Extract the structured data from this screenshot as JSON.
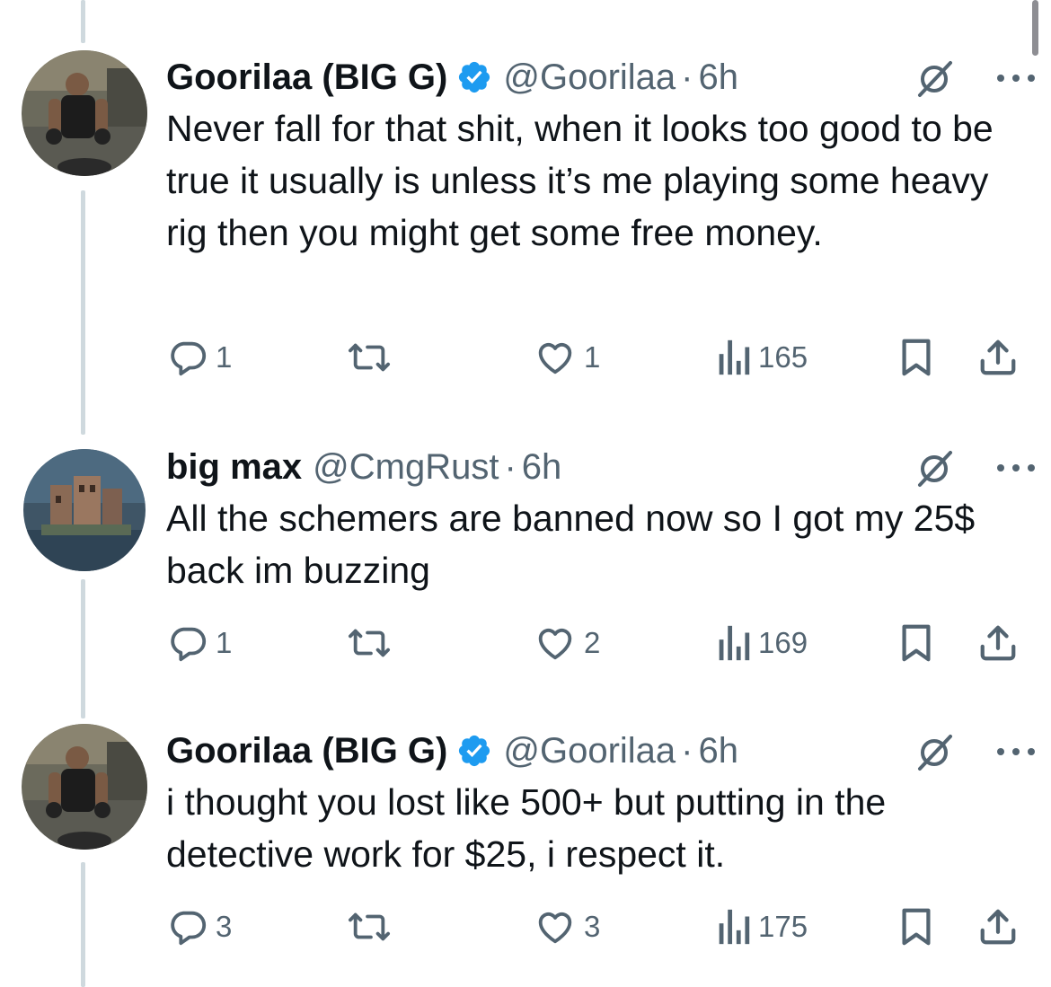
{
  "tweets": [
    {
      "name": "Goorilaa (BIG G)",
      "verified": true,
      "handle": "@Goorilaa",
      "time": "6h",
      "separator": "·",
      "text": "Never fall for that shit, when it looks too good to be true it usually is unless it’s me playing some heavy rig then you might get some free money.",
      "replies": "1",
      "reposts": "",
      "likes": "1",
      "views": "165"
    },
    {
      "name": "big max",
      "verified": false,
      "handle": "@CmgRust",
      "time": "6h",
      "separator": "·",
      "text": "All the schemers are banned now so I got my 25$ back im buzzing",
      "replies": "1",
      "reposts": "",
      "likes": "2",
      "views": "169"
    },
    {
      "name": "Goorilaa (BIG G)",
      "verified": true,
      "handle": "@Goorilaa",
      "time": "6h",
      "separator": "·",
      "text": "i thought you lost like 500+ but putting in the detective work for $25, i respect it.",
      "replies": "3",
      "reposts": "",
      "likes": "3",
      "views": "175"
    }
  ],
  "icons": {
    "verified": "verified-badge-icon",
    "grok": "grok-icon",
    "more": "more-options-icon",
    "reply": "reply-icon",
    "repost": "repost-icon",
    "like": "like-icon",
    "views": "views-icon",
    "bookmark": "bookmark-icon",
    "share": "share-icon"
  },
  "colors": {
    "text": "#0f1419",
    "secondary": "#536471",
    "verified": "#1d9bf0",
    "thread_line": "#cfd9de"
  }
}
